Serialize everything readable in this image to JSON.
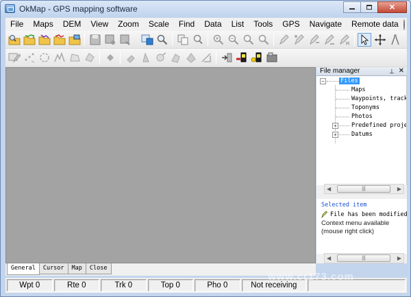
{
  "window": {
    "title": "OkMap - GPS mapping software"
  },
  "menu": [
    "File",
    "Maps",
    "DEM",
    "View",
    "Zoom",
    "Scale",
    "Find",
    "Data",
    "List",
    "Tools",
    "GPS",
    "Navigate",
    "Remote data"
  ],
  "file_manager": {
    "title": "File manager",
    "close_glyph": "✕",
    "tree": {
      "root": "Files",
      "children": [
        "Maps",
        "Waypoints, tracks",
        "Toponyms",
        "Photos",
        "Predefined projections",
        "Datums"
      ]
    },
    "selected_item_title": "Selected item",
    "status": "File has been modified",
    "context_hint": "Context menu available (mouse right click)"
  },
  "tabs": [
    "General",
    "Cursor",
    "Map",
    "Close"
  ],
  "status_bar": [
    {
      "label": "Wpt 0"
    },
    {
      "label": "Rte 0"
    },
    {
      "label": "Trk 0"
    },
    {
      "label": "Top 0"
    },
    {
      "label": "Pho 0"
    },
    {
      "label": "Not receiving"
    }
  ],
  "watermark": "www.cr173.com",
  "colors": {
    "map_bg": "#a3a3a3",
    "selection": "#3399ff",
    "selected_item_text": "#1a4fd0"
  }
}
